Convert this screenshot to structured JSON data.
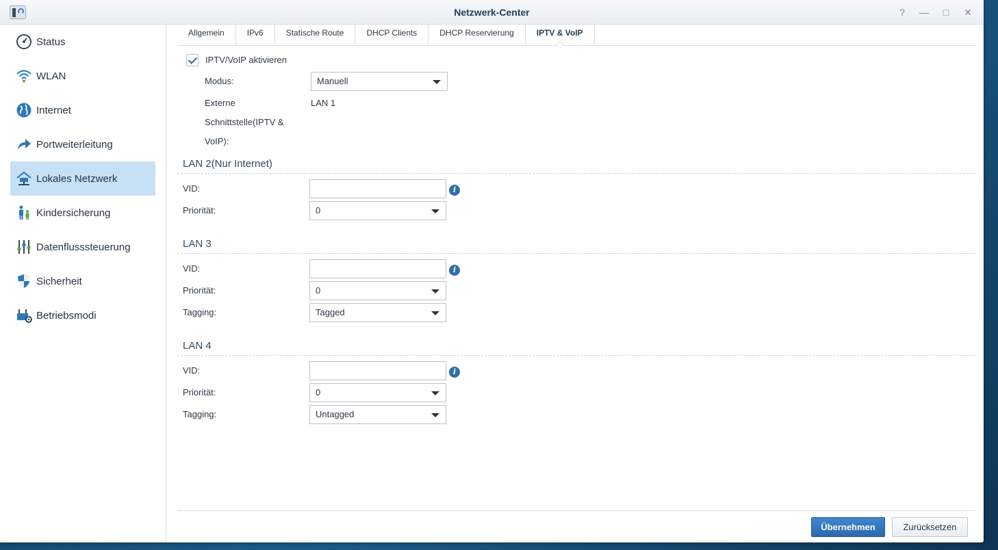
{
  "window": {
    "title": "Netzwerk-Center"
  },
  "window_controls": [
    "?",
    "—",
    "□",
    "✕"
  ],
  "sidebar": {
    "items": [
      {
        "label": "Status",
        "icon": "speedometer-icon"
      },
      {
        "label": "WLAN",
        "icon": "wifi-icon"
      },
      {
        "label": "Internet",
        "icon": "globe-icon"
      },
      {
        "label": "Portweiterleitung",
        "icon": "forward-arrow-icon"
      },
      {
        "label": "Lokales Netzwerk",
        "icon": "home-network-icon",
        "active": true
      },
      {
        "label": "Kindersicherung",
        "icon": "parent-child-icon"
      },
      {
        "label": "Datenflusssteuerung",
        "icon": "sliders-icon"
      },
      {
        "label": "Sicherheit",
        "icon": "shield-icon"
      },
      {
        "label": "Betriebsmodi",
        "icon": "router-gear-icon"
      }
    ]
  },
  "tabs": [
    {
      "label": "Allgemein"
    },
    {
      "label": "IPv6"
    },
    {
      "label": "Statische Route"
    },
    {
      "label": "DHCP Clients"
    },
    {
      "label": "DHCP Reservierung"
    },
    {
      "label": "IPTV & VoIP",
      "active": true
    }
  ],
  "general": {
    "enable_label": "IPTV/VoIP aktivieren",
    "enabled": true,
    "mode_label": "Modus:",
    "mode_value": "Manuell",
    "external_label_line1": "Externe",
    "external_label_line2": "Schnittstelle(IPTV &",
    "external_label_line3": "VoIP):",
    "external_value": "LAN 1"
  },
  "lan2": {
    "title": "LAN 2(Nur Internet)",
    "vid_label": "VID:",
    "vid_value": "",
    "priority_label": "Priorität:",
    "priority_value": "0"
  },
  "lan3": {
    "title": "LAN 3",
    "vid_label": "VID:",
    "vid_value": "",
    "priority_label": "Priorität:",
    "priority_value": "0",
    "tagging_label": "Tagging:",
    "tagging_value": "Tagged"
  },
  "lan4": {
    "title": "LAN 4",
    "vid_label": "VID:",
    "vid_value": "",
    "priority_label": "Priorität:",
    "priority_value": "0",
    "tagging_label": "Tagging:",
    "tagging_value": "Untagged"
  },
  "info_icon_glyph": "i",
  "footer": {
    "apply_label": "Übernehmen",
    "reset_label": "Zurücksetzen"
  },
  "colors": {
    "accent": "#2d6db0",
    "active_nav_bg": "#c6e0f6",
    "title_text": "#1f3d5a"
  }
}
